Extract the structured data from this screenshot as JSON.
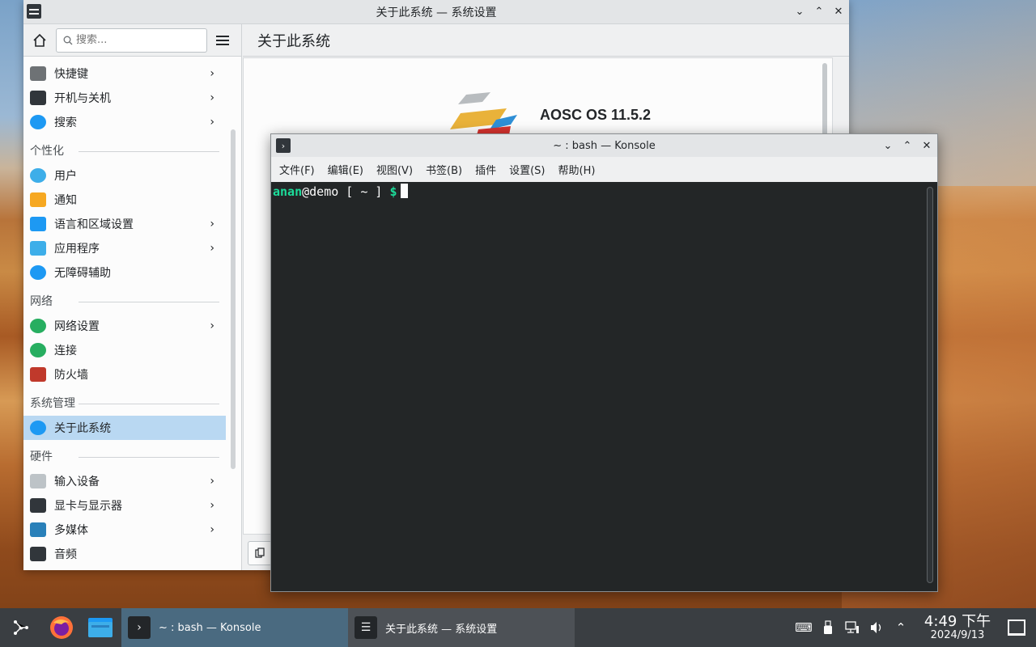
{
  "settings": {
    "window_title": "关于此系统 — 系统设置",
    "search_placeholder": "搜索...",
    "page_title": "关于此系统",
    "os_name": "AOSC OS 11.5.2",
    "sidebar": {
      "items_top": [
        {
          "label": "快捷键",
          "icon": "keyboard-icon",
          "chevron": true
        },
        {
          "label": "开机与关机",
          "icon": "monitor-icon",
          "chevron": true
        },
        {
          "label": "搜索",
          "icon": "search-icon",
          "chevron": true
        }
      ],
      "cat_personal": "个性化",
      "items_personal": [
        {
          "label": "用户",
          "icon": "users-icon",
          "chevron": false
        },
        {
          "label": "通知",
          "icon": "bell-icon",
          "chevron": false
        },
        {
          "label": "语言和区域设置",
          "icon": "language-icon",
          "chevron": true
        },
        {
          "label": "应用程序",
          "icon": "apps-icon",
          "chevron": true
        },
        {
          "label": "无障碍辅助",
          "icon": "accessibility-icon",
          "chevron": false
        }
      ],
      "cat_network": "网络",
      "items_network": [
        {
          "label": "网络设置",
          "icon": "globe-icon",
          "chevron": true
        },
        {
          "label": "连接",
          "icon": "globe-icon",
          "chevron": false
        },
        {
          "label": "防火墙",
          "icon": "firewall-icon",
          "chevron": false
        }
      ],
      "cat_admin": "系统管理",
      "items_admin": [
        {
          "label": "关于此系统",
          "icon": "info-icon",
          "chevron": false
        }
      ],
      "cat_hardware": "硬件",
      "items_hardware": [
        {
          "label": "输入设备",
          "icon": "mouse-icon",
          "chevron": true
        },
        {
          "label": "显卡与显示器",
          "icon": "display-icon",
          "chevron": true
        },
        {
          "label": "多媒体",
          "icon": "multimedia-icon",
          "chevron": true
        },
        {
          "label": "音频",
          "icon": "speaker-icon",
          "chevron": false
        }
      ]
    }
  },
  "konsole": {
    "window_title": "~ : bash — Konsole",
    "menu": [
      "文件(F)",
      "编辑(E)",
      "视图(V)",
      "书签(B)",
      "插件",
      "设置(S)",
      "帮助(H)"
    ],
    "prompt_user": "anan",
    "prompt_host": "@demo",
    "prompt_path": " [ ~ ] ",
    "prompt_symbol": "$"
  },
  "taskbar": {
    "task_konsole": "~ : bash — Konsole",
    "task_settings": "关于此系统 — 系统设置",
    "time": "4:49 下午",
    "date": "2024/9/13"
  },
  "colors": {
    "accent": "#3daee9",
    "selection": "#b9d8f2",
    "terminal_bg": "#232627",
    "prompt_green": "#1cdc9a",
    "taskbar": "#3a3e42"
  }
}
